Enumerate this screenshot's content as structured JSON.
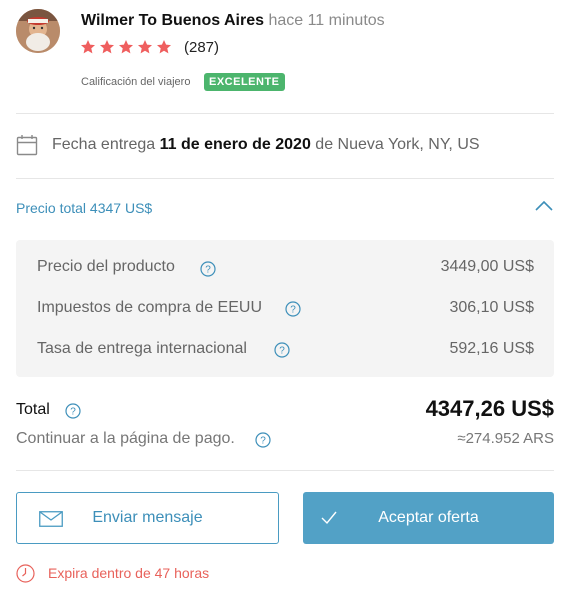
{
  "header": {
    "user_name": "Wilmer To Buenos Aires",
    "posted_time": "hace 11 minutos",
    "rating_stars": 5,
    "review_count": "(287)",
    "traveler_rating_label": "Calificación del viajero",
    "traveler_rating_badge": "EXCELENTE"
  },
  "delivery": {
    "prefix": "Fecha entrega",
    "date": "11 de enero de 2020",
    "origin": "de Nueva York, NY, US"
  },
  "price_toggle": {
    "label": "Precio total 4347 US$"
  },
  "breakdown": [
    {
      "label": "Precio del producto",
      "value": "3449,00 US$"
    },
    {
      "label": "Impuestos de compra de EEUU",
      "value": "306,10 US$"
    },
    {
      "label": "Tasa de entrega internacional",
      "value": "592,16 US$"
    }
  ],
  "totals": {
    "label": "Total",
    "value": "4347,26 US$",
    "continue_label": "Continuar a la página de pago.",
    "converted_value": "≈274.952 ARS"
  },
  "actions": {
    "message_label": "Enviar mensaje",
    "accept_label": "Aceptar oferta"
  },
  "expiry": {
    "text": "Expira dentro de 47 horas"
  },
  "colors": {
    "accent_blue": "#52a1c6",
    "link_blue": "#3d8fb9",
    "star_red": "#ef5e5e",
    "badge_green": "#4cb56d",
    "expiry_red": "#e8625b"
  }
}
